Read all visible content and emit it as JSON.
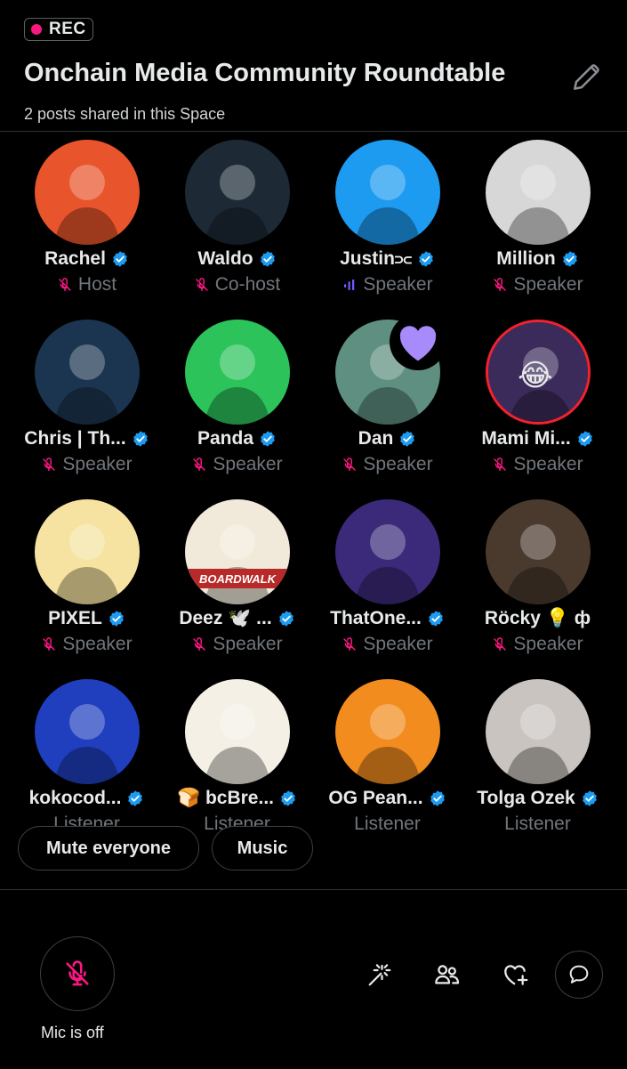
{
  "recording": {
    "label": "REC"
  },
  "space": {
    "title": "Onchain Media Community Roundtable",
    "subtitle": "2 posts shared in this Space"
  },
  "participants": [
    {
      "name": "Rachel",
      "role": "Host",
      "status": "muted",
      "verified": true,
      "extra": "",
      "avatar_bg": "#e8542b"
    },
    {
      "name": "Waldo",
      "role": "Co-host",
      "status": "muted",
      "verified": true,
      "extra": "",
      "avatar_bg": "#1d2a36"
    },
    {
      "name": "Justin⫗",
      "role": "Speaker",
      "status": "speaking",
      "verified": true,
      "extra": "",
      "avatar_bg": "#1d9bf0"
    },
    {
      "name": "Million",
      "role": "Speaker",
      "status": "muted",
      "verified": true,
      "extra": "",
      "avatar_bg": "#d7d7d7"
    },
    {
      "name": "Chris | Th...",
      "role": "Speaker",
      "status": "muted",
      "verified": true,
      "extra": "",
      "avatar_bg": "#1b3550"
    },
    {
      "name": "Panda",
      "role": "Speaker",
      "status": "muted",
      "verified": true,
      "extra": "",
      "avatar_bg": "#2cc45a"
    },
    {
      "name": "Dan",
      "role": "Speaker",
      "status": "muted",
      "verified": true,
      "extra": "",
      "avatar_bg": "#5f8f80",
      "reaction": "heart"
    },
    {
      "name": "Mami Mi...",
      "role": "Speaker",
      "status": "muted",
      "verified": true,
      "extra": "",
      "avatar_bg": "#3b2b5a",
      "reaction": "😂"
    },
    {
      "name": "PIXEL",
      "role": "Speaker",
      "status": "muted",
      "verified": true,
      "extra": "",
      "avatar_bg": "#f6e3a1"
    },
    {
      "name": "Deez 🕊️ ...",
      "role": "Speaker",
      "status": "muted",
      "verified": true,
      "extra": "BOARDWALK",
      "avatar_bg": "#f1e9da"
    },
    {
      "name": "ThatOne...",
      "role": "Speaker",
      "status": "muted",
      "verified": true,
      "extra": "",
      "avatar_bg": "#3b2a7a"
    },
    {
      "name": "Röcky 💡 ф",
      "role": "Speaker",
      "status": "muted",
      "verified": false,
      "extra": "",
      "avatar_bg": "#4a3a2e"
    },
    {
      "name": "kokocod...",
      "role": "Listener",
      "status": "none",
      "verified": true,
      "extra": "",
      "avatar_bg": "#1f3fbf"
    },
    {
      "name": "🍞 bcBre...",
      "role": "Listener",
      "status": "none",
      "verified": true,
      "extra": "",
      "avatar_bg": "#f4f0e6"
    },
    {
      "name": "OG Pean...",
      "role": "Listener",
      "status": "none",
      "verified": true,
      "extra": "",
      "avatar_bg": "#f28c1e"
    },
    {
      "name": "Tolga Ozek",
      "role": "Listener",
      "status": "none",
      "verified": true,
      "extra": "",
      "avatar_bg": "#c9c4bf"
    }
  ],
  "actions": {
    "mute_everyone": "Mute everyone",
    "music": "Music"
  },
  "mic": {
    "label": "Mic is off"
  },
  "toolbar": {
    "icons": [
      "sparkle-wand-icon",
      "people-icon",
      "heart-plus-icon",
      "chat-bubble-icon"
    ]
  },
  "colors": {
    "accent": "#1d9bf0",
    "muted_pink": "#f91880",
    "speaking_purple": "#7856ff",
    "text_dim": "#71767b"
  }
}
